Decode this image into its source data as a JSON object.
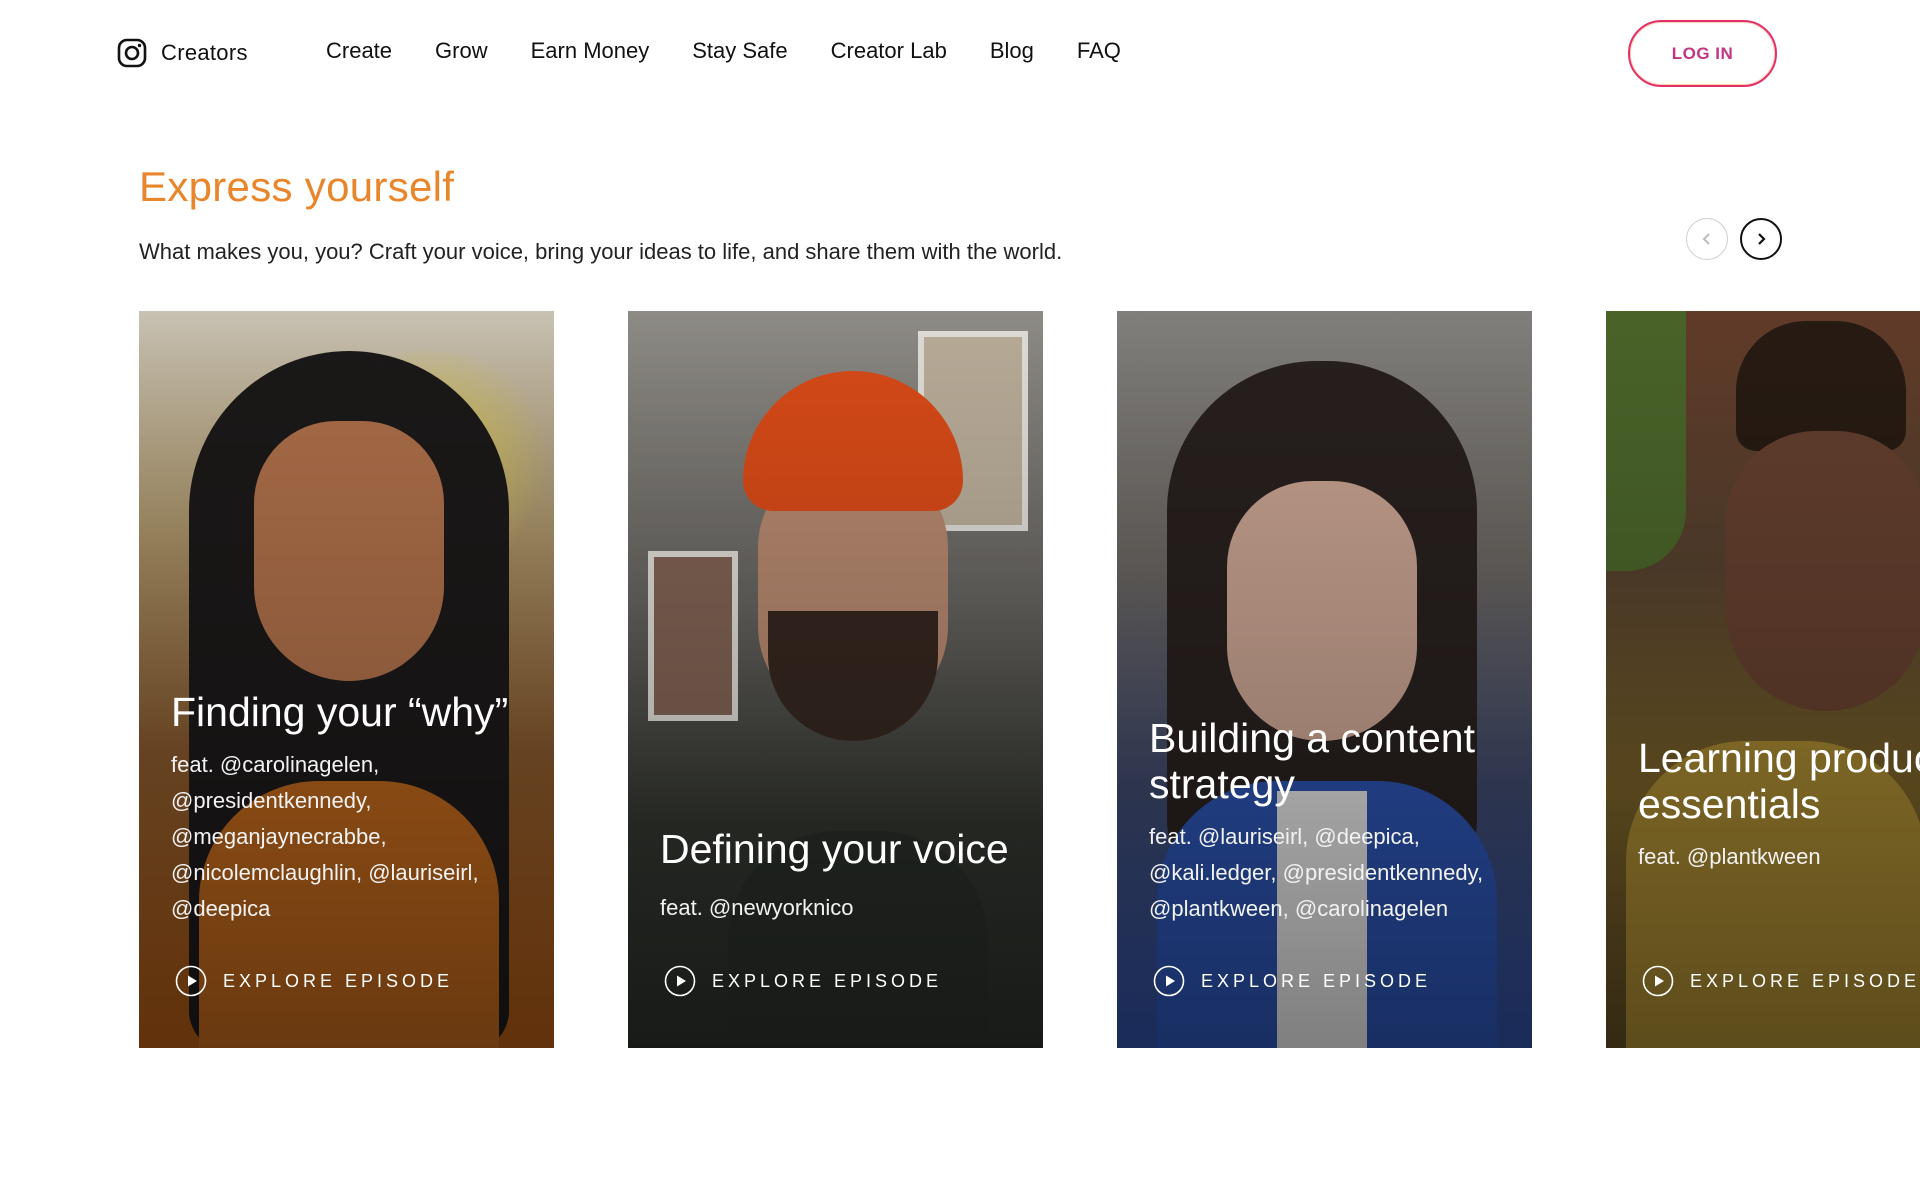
{
  "header": {
    "brand": {
      "label": "Creators",
      "icon": "instagram-icon"
    },
    "nav": [
      {
        "label": "Create"
      },
      {
        "label": "Grow"
      },
      {
        "label": "Earn Money"
      },
      {
        "label": "Stay Safe"
      },
      {
        "label": "Creator Lab"
      },
      {
        "label": "Blog"
      },
      {
        "label": "FAQ"
      }
    ],
    "login_label": "LOG IN"
  },
  "section": {
    "title": "Express yourself",
    "subtitle": "What makes you, you? Craft your voice, bring your ideas to life, and share them with the world."
  },
  "carousel": {
    "prev_icon": "chevron-left-icon",
    "next_icon": "chevron-right-icon",
    "cards": [
      {
        "title": "Finding your “why”",
        "feat": "feat. @carolinagelen, @presidentkennedy, @meganjaynecrabbe, @nicolemclaughlin, @lauriseirl, @deepica",
        "cta": "EXPLORE EPISODE"
      },
      {
        "title": "Defining your voice",
        "feat": "feat. @newyorknico",
        "cta": "EXPLORE EPISODE"
      },
      {
        "title": "Building a content strategy",
        "feat": "feat. @lauriseirl, @deepica, @kali.ledger, @presidentkennedy, @plantkween, @carolinagelen",
        "cta": "EXPLORE EPISODE"
      },
      {
        "title": "Learning production essentials",
        "feat": "feat. @plantkween",
        "cta": "EXPLORE EPISODE"
      }
    ]
  },
  "colors": {
    "accent_orange": "#e9862c",
    "login_pink": "#c13584",
    "text": "#111111"
  }
}
